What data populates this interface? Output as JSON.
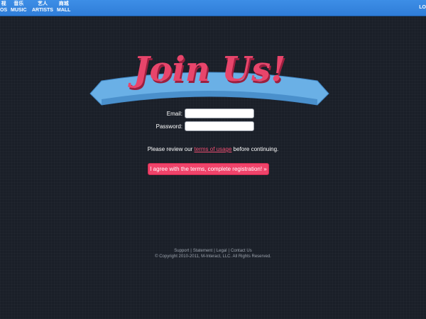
{
  "nav": {
    "items": [
      {
        "cn": "视",
        "en": "OS"
      },
      {
        "cn": "音乐",
        "en": "MUSIC"
      },
      {
        "cn": "艺人",
        "en": "ARTISTS"
      },
      {
        "cn": "商城",
        "en": "MALL"
      }
    ],
    "login": "LO"
  },
  "logo": {
    "text": "Join Us!",
    "text_color": "#e8456b",
    "ribbon_color": "#6ab0e6"
  },
  "form": {
    "email_label": "Email:",
    "email_value": "",
    "password_label": "Password:",
    "password_value": ""
  },
  "review": {
    "before": "Please review our ",
    "link": "terms of usage",
    "after": " before continuing."
  },
  "agree_button": "I agree with the terms, complete registration! »",
  "footer": {
    "links": [
      "Support",
      "Statement",
      "Legal",
      "Contact Us"
    ],
    "copyright": "© Copyright 2010-2011, M-Interact, LLC. All Rights Reserved."
  },
  "colors": {
    "topbar": "#2f7dd8",
    "background": "#1a1f28",
    "accent": "#f0436a"
  }
}
